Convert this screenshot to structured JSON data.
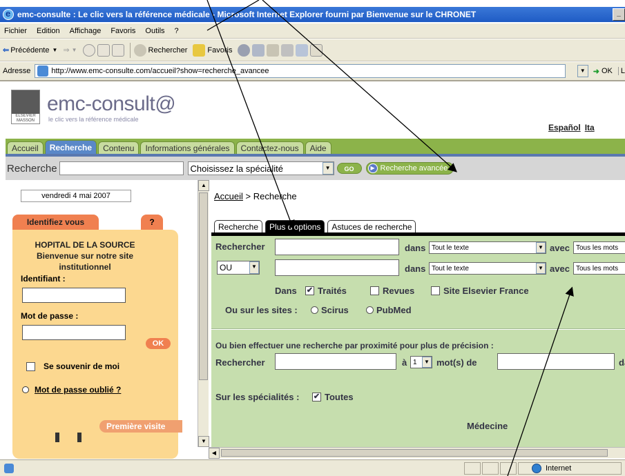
{
  "window": {
    "title": "emc-consulte : Le clic vers la référence médicale - Microsoft Internet Explorer fourni par Bienvenue sur le CHRONET",
    "min_label": "_"
  },
  "menu": [
    "Fichier",
    "Edition",
    "Affichage",
    "Favoris",
    "Outils",
    "?"
  ],
  "toolbar": {
    "back": "Précédente",
    "search": "Rechercher",
    "favorites": "Favoris"
  },
  "address": {
    "label": "Adresse",
    "url": "http://www.emc-consulte.com/accueil?show=recherche_avancee",
    "go": "OK",
    "links": "L"
  },
  "site": {
    "elsevier": "ELSEVIER MASSON",
    "logo": "emc-consult@",
    "tagline": "le clic vers la référence médicale",
    "languages": [
      "Español",
      "Ita"
    ]
  },
  "nav_tabs": [
    "Accueil",
    "Recherche",
    "Contenu",
    "Informations générales",
    "Contactez-nous",
    "Aide"
  ],
  "searchbar": {
    "label": "Recherche",
    "specialty_placeholder": "Choisissez la spécialité",
    "go": "GO",
    "advanced": "Recherche avancée"
  },
  "left": {
    "date": "vendredi 4 mai 2007",
    "identify_tab": "Identifiez vous",
    "help_tab": "?",
    "hospital_lines": [
      "HOPITAL DE LA SOURCE",
      "Bienvenue sur notre site",
      "institutionnel"
    ],
    "identifiant_label": "Identifiant :",
    "password_label": "Mot de passe :",
    "ok": "OK",
    "remember": "Se souvenir de moi",
    "forgot": "Mot de passe oublié ?",
    "first_visit": "Première visite"
  },
  "main": {
    "breadcrumb_home": "Accueil",
    "breadcrumb_sep": " > ",
    "breadcrumb_current": "Recherche",
    "subtabs": [
      "Recherche",
      "Plus d'options",
      "Astuces de recherche"
    ],
    "search_label": "Rechercher",
    "dans": "dans",
    "avec": "avec",
    "scope_value": "Tout le texte",
    "words_value": "Tous les mots",
    "operator_value": "OU",
    "dans_label": "Dans",
    "sources": [
      {
        "label": "Traités",
        "checked": "✔"
      },
      {
        "label": "Revues",
        "checked": ""
      },
      {
        "label": "Site Elsevier France",
        "checked": ""
      }
    ],
    "sites_label": "Ou sur les sites :",
    "sites": [
      "Scirus",
      "PubMed"
    ],
    "proximity_title": "Ou bien effectuer une recherche par proximité pour plus de précision :",
    "proximity_search_label": "Rechercher",
    "a_label": "à",
    "proximity_count": "1",
    "words_of": "mot(s) de",
    "da_label": "da",
    "specialties_label": "Sur les spécialités :",
    "all_label": "Toutes",
    "all_checked": "✔",
    "medecine": "Médecine"
  },
  "status": {
    "zone": "Internet"
  }
}
